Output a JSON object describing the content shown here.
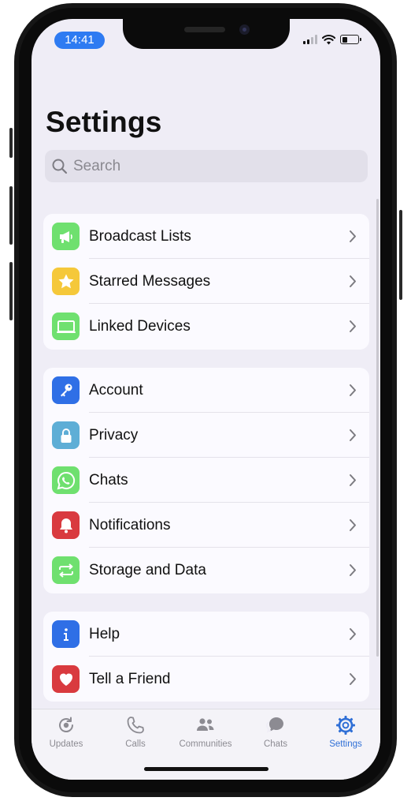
{
  "status_bar": {
    "time": "14:41"
  },
  "page": {
    "title": "Settings"
  },
  "search": {
    "placeholder": "Search"
  },
  "groups": [
    {
      "items": [
        {
          "label": "Broadcast Lists",
          "icon": "megaphone-icon",
          "color": "#6fe06f"
        },
        {
          "label": "Starred Messages",
          "icon": "star-icon",
          "color": "#f5c83a"
        },
        {
          "label": "Linked Devices",
          "icon": "laptop-icon",
          "color": "#6fe06f"
        }
      ]
    },
    {
      "items": [
        {
          "label": "Account",
          "icon": "key-icon",
          "color": "#2f6fe6"
        },
        {
          "label": "Privacy",
          "icon": "lock-icon",
          "color": "#5eaed6"
        },
        {
          "label": "Chats",
          "icon": "whatsapp-icon",
          "color": "#6fe06f"
        },
        {
          "label": "Notifications",
          "icon": "bell-icon",
          "color": "#d93a3f"
        },
        {
          "label": "Storage and Data",
          "icon": "sync-arrows-icon",
          "color": "#6fe06f"
        }
      ]
    },
    {
      "items": [
        {
          "label": "Help",
          "icon": "info-icon",
          "color": "#2f6fe6"
        },
        {
          "label": "Tell a Friend",
          "icon": "heart-icon",
          "color": "#d93a3f"
        }
      ]
    }
  ],
  "tabbar": {
    "tabs": [
      {
        "label": "Updates",
        "icon": "updates-icon",
        "active": false
      },
      {
        "label": "Calls",
        "icon": "phone-icon",
        "active": false
      },
      {
        "label": "Communities",
        "icon": "communities-icon",
        "active": false
      },
      {
        "label": "Chats",
        "icon": "chats-bubble-icon",
        "active": false
      },
      {
        "label": "Settings",
        "icon": "gear-icon",
        "active": true
      }
    ]
  },
  "colors": {
    "accent": "#2f6fd6",
    "background": "#efedf6",
    "time_pill": "#2e7bf2"
  }
}
